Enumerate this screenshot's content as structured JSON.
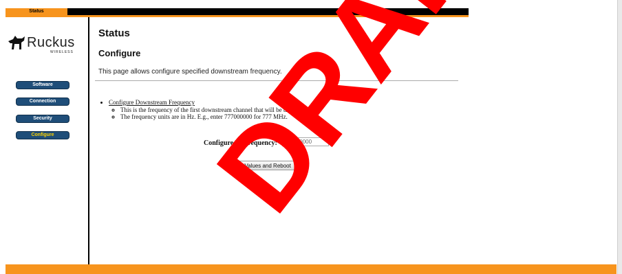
{
  "header": {
    "status_tab": "Status"
  },
  "logo": {
    "brand": "Ruckus",
    "tagline": "WIRELESS"
  },
  "sidebar": {
    "items": [
      {
        "label": "Software"
      },
      {
        "label": "Connection"
      },
      {
        "label": "Security"
      },
      {
        "label": "Configure"
      }
    ],
    "active_item": "Configure"
  },
  "main": {
    "page_title": "Status",
    "section_title": "Configure",
    "description": "This page allows configure specified downstream frequency.",
    "info": {
      "link_text": "Configure Downstream Frequency",
      "notes": [
        "This is the frequency of the first downstream channel that will be tried.",
        "The frequency units are in Hz. E.g., enter 777000000 for 777 MHz."
      ]
    },
    "form": {
      "ds_frequency_label": "Configure DS frequency:",
      "ds_frequency_value": "525000000",
      "submit_label": "Set Values and Reboot"
    }
  },
  "watermark": {
    "text": "DRAFT",
    "color": "#ff0000"
  },
  "colors": {
    "accent_orange": "#f7941d",
    "nav_blue": "#1f4e79",
    "active_yellow": "#ffd400"
  }
}
